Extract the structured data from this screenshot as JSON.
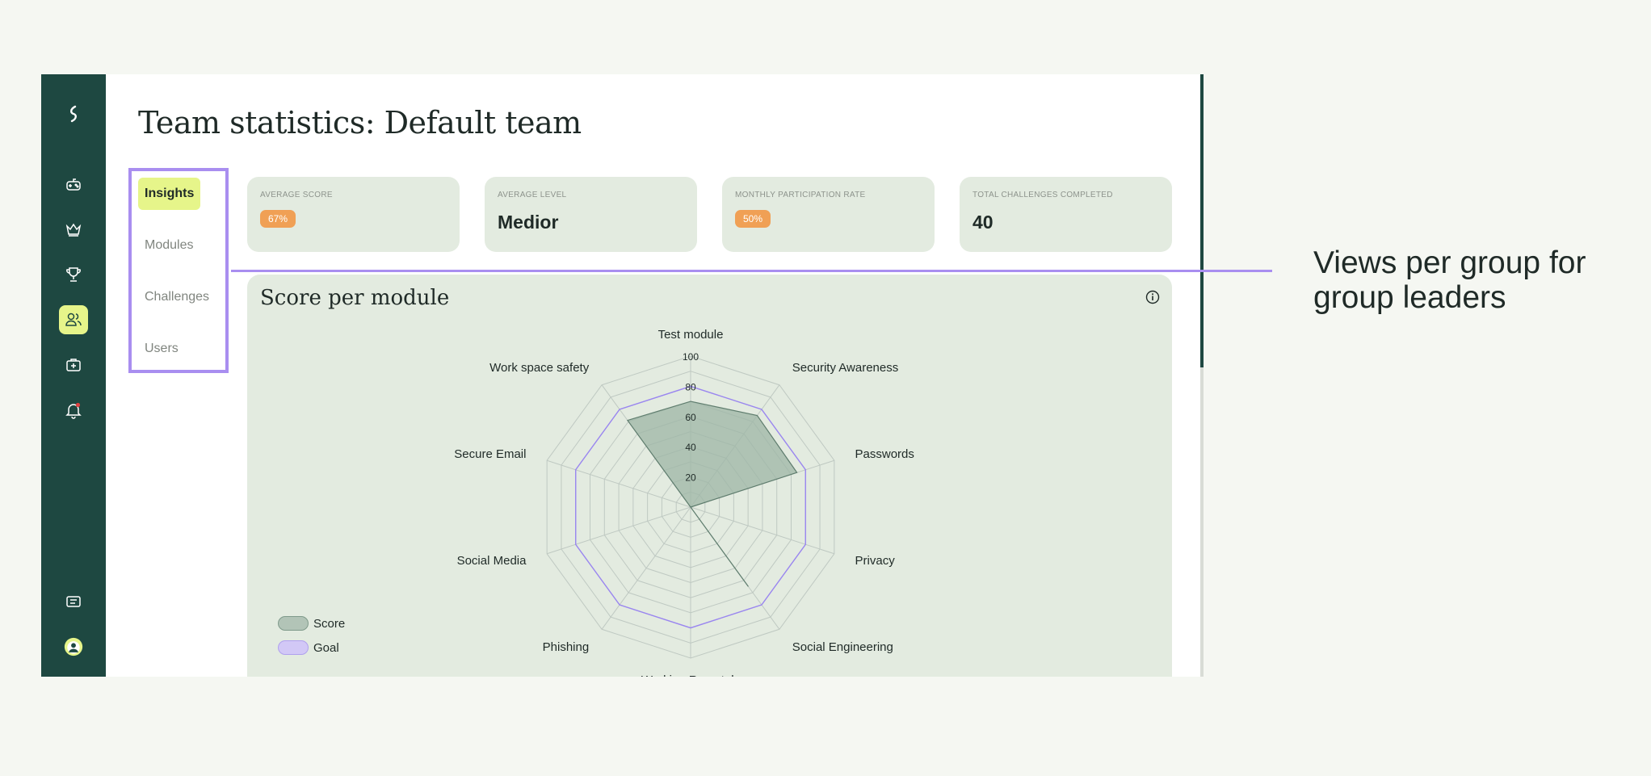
{
  "page": {
    "title": "Team statistics: Default team"
  },
  "sidebar": {
    "items": [
      {
        "icon": "logo-icon"
      },
      {
        "icon": "gamepad-icon"
      },
      {
        "icon": "crown-icon"
      },
      {
        "icon": "trophy-icon"
      },
      {
        "icon": "users-icon",
        "active": true
      },
      {
        "icon": "first-aid-kit-icon"
      },
      {
        "icon": "bell-icon",
        "has_notification": true
      },
      {
        "icon": "message-icon"
      },
      {
        "icon": "avatar"
      }
    ]
  },
  "tabs": [
    {
      "label": "Insights",
      "active": true
    },
    {
      "label": "Modules"
    },
    {
      "label": "Challenges"
    },
    {
      "label": "Users"
    }
  ],
  "stats": [
    {
      "label": "AVERAGE SCORE",
      "value": "67%",
      "style": "pill"
    },
    {
      "label": "AVERAGE LEVEL",
      "value": "Medior",
      "style": "big"
    },
    {
      "label": "MONTHLY PARTICIPATION RATE",
      "value": "50%",
      "style": "pill"
    },
    {
      "label": "TOTAL CHALLENGES COMPLETED",
      "value": "40",
      "style": "big"
    }
  ],
  "chart": {
    "title": "Score per module"
  },
  "chart_data": {
    "type": "radar",
    "axes": [
      "Test module",
      "Security Awareness",
      "Passwords",
      "Privacy",
      "Social Engineering",
      "Working Remotely",
      "Phishing",
      "Social Media",
      "Secure Email",
      "Work space safety"
    ],
    "rticks": [
      20,
      40,
      60,
      80,
      100
    ],
    "rlim": [
      0,
      100
    ],
    "series": [
      {
        "name": "Score",
        "values": [
          70,
          75,
          74,
          0,
          65,
          0,
          0,
          0,
          0,
          71
        ]
      },
      {
        "name": "Goal",
        "values": [
          80,
          80,
          80,
          80,
          80,
          80,
          80,
          80,
          80,
          80
        ]
      }
    ],
    "legend_position": "bottom-left",
    "colors": {
      "score_fill": "#9db5a6",
      "score_stroke": "#5f7d6e",
      "goal_stroke": "#9a86f0",
      "grid": "#bfc9c2"
    }
  },
  "annotation": {
    "text": "Views per group for group leaders"
  },
  "colors": {
    "sidebar_bg": "#1e4841",
    "accent": "#e6f58a",
    "card_bg": "#e3ebe0",
    "pill_bg": "#f0a055",
    "highlight": "#a98ef0"
  }
}
